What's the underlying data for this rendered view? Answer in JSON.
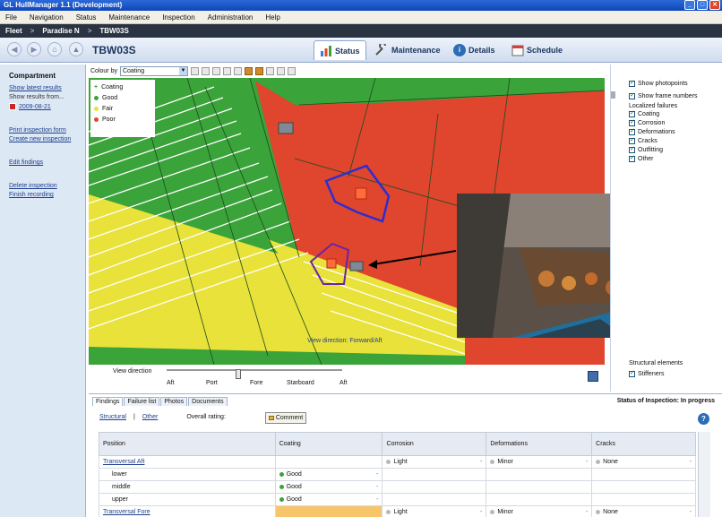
{
  "window": {
    "title": "GL HullManager 1.1 (Development)"
  },
  "menu": [
    "File",
    "Navigation",
    "Status",
    "Maintenance",
    "Inspection",
    "Administration",
    "Help"
  ],
  "breadcrumb": [
    "Fleet",
    "Paradise N",
    "TBW03S"
  ],
  "asset_title": "TBW03S",
  "tabs": [
    {
      "label": "Status",
      "active": true
    },
    {
      "label": "Maintenance",
      "active": false
    },
    {
      "label": "Details",
      "active": false
    },
    {
      "label": "Schedule",
      "active": false
    }
  ],
  "sidebar": {
    "heading": "Compartment",
    "show_latest": "Show latest results",
    "show_results_from": "Show results from...",
    "date": "2009-08-21",
    "print_form": "Print inspection form",
    "create_inspection": "Create new inspection",
    "edit_findings": "Edit findings",
    "delete_inspection": "Delete inspection",
    "finish_recording": "Finish recording"
  },
  "viewer": {
    "colour_by_label": "Colour by",
    "colour_by_value": "Coating",
    "legend": {
      "title": "Coating",
      "items": [
        {
          "label": "Good",
          "color": "#3aa33a"
        },
        {
          "label": "Fair",
          "color": "#e8e23a"
        },
        {
          "label": "Poor",
          "color": "#e0452e"
        }
      ]
    },
    "view_direction_caption": "View direction: Forward/Aft",
    "view_direction_label": "View direction",
    "slider_labels": [
      "Aft",
      "Port",
      "Fore",
      "Starboard",
      "Aft"
    ],
    "slider_value_fraction": 0.41
  },
  "right_panel": {
    "show_photopoints": "Show photopoints",
    "show_frame_numbers": "Show frame numbers",
    "localized_failures_title": "Localized failures",
    "failures": [
      "Coating",
      "Corrosion",
      "Deformations",
      "Cracks",
      "Outfitting",
      "Other"
    ],
    "structural_title": "Structural elements",
    "structural_items": [
      "Stiffeners"
    ]
  },
  "bottom": {
    "tabs": [
      "Findings",
      "Failure list",
      "Photos",
      "Documents"
    ],
    "status": "Status of Inspection: In progress",
    "sub_links": [
      "Structural",
      "Other"
    ],
    "overall_rating_label": "Overall rating:",
    "comment_button": "Comment",
    "columns": [
      "Position",
      "Coating",
      "Corrosion",
      "Deformations",
      "Cracks"
    ],
    "rows": [
      {
        "position": "Transversal Aft",
        "group": true,
        "coating": "",
        "corrosion": "Light",
        "deformations": "Minor",
        "cracks": "None"
      },
      {
        "position": "lower",
        "group": false,
        "coating": "Good",
        "corrosion": "",
        "deformations": "",
        "cracks": ""
      },
      {
        "position": "middle",
        "group": false,
        "coating": "Good",
        "corrosion": "",
        "deformations": "",
        "cracks": ""
      },
      {
        "position": "upper",
        "group": false,
        "coating": "Good",
        "corrosion": "",
        "deformations": "",
        "cracks": ""
      },
      {
        "position": "Transversal Fore",
        "group": true,
        "coating": "",
        "corrosion": "Light",
        "deformations": "Minor",
        "cracks": "None"
      }
    ]
  },
  "colors": {
    "good": "#3aa33a",
    "fair": "#e8e23a",
    "poor": "#e0452e",
    "rating_grey": "#b8b8b8",
    "accent": "#1d3561"
  }
}
